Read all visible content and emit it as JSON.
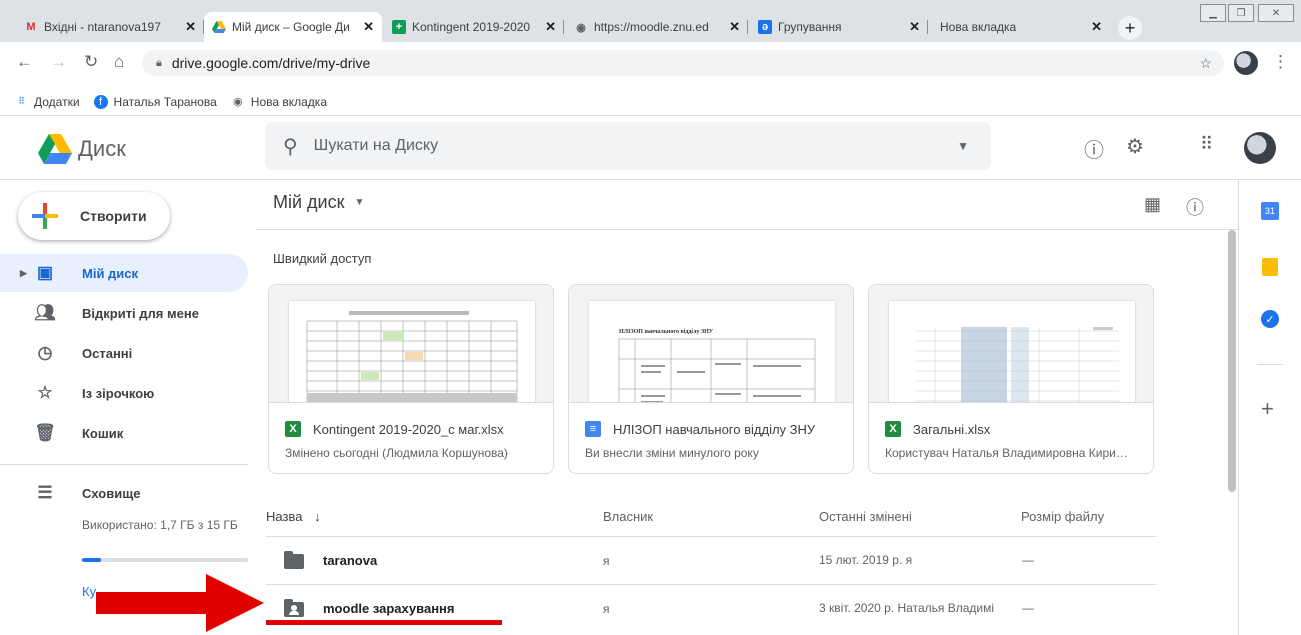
{
  "browser": {
    "tabs": [
      {
        "title": "Вхідні - ntaranova197",
        "icon": "gmail-icon",
        "active": false
      },
      {
        "title": "Мій диск – Google Ди",
        "icon": "google-drive-icon",
        "active": true
      },
      {
        "title": "Kontingent 2019-2020",
        "icon": "google-sheets-icon",
        "active": false
      },
      {
        "title": "https://moodle.znu.ed",
        "icon": "globe-icon",
        "active": false
      },
      {
        "title": "Групування",
        "icon": "moodle-icon",
        "active": false
      },
      {
        "title": "Нова вкладка",
        "icon": "",
        "active": false
      }
    ],
    "url": "drive.google.com/drive/my-drive",
    "bookmarks": [
      {
        "label": "Додатки",
        "icon": "apps-grid-icon"
      },
      {
        "label": "Наталья Таранова",
        "icon": "facebook-icon"
      },
      {
        "label": "Нова вкладка",
        "icon": "globe-icon"
      }
    ]
  },
  "header": {
    "brand": "Диск",
    "search_placeholder": "Шукати на Диску"
  },
  "sidebar": {
    "create_label": "Створити",
    "items": [
      {
        "label": "Мій диск",
        "icon": "my-drive-icon",
        "active": true
      },
      {
        "label": "Відкриті для мене",
        "icon": "shared-icon",
        "active": false
      },
      {
        "label": "Останні",
        "icon": "clock-icon",
        "active": false
      },
      {
        "label": "Із зірочкою",
        "icon": "star-icon",
        "active": false
      },
      {
        "label": "Кошик",
        "icon": "trash-icon",
        "active": false
      }
    ],
    "storage_label": "Сховище",
    "storage_used": "Використано: 1,7 ГБ з 15 ГБ",
    "storage_fraction": 0.113,
    "buy_link": "Ку"
  },
  "main": {
    "title": "Мій диск",
    "quick_access_label": "Швидкий доступ",
    "cards": [
      {
        "name": "Kontingent 2019-2020_c маг.xlsx",
        "subtitle": "Змінено сьогодні (Людмила Коршунова)",
        "type": "X",
        "color": "#1e8e3e"
      },
      {
        "name": "НЛІЗОП навчального відділу ЗНУ",
        "subtitle": "Ви внесли зміни минулого року",
        "type": "≡",
        "color": "#4285f4"
      },
      {
        "name": "Загальні.xlsx",
        "subtitle": "Користувач Наталья Владимировна Кири…",
        "type": "X",
        "color": "#1e8e3e"
      }
    ],
    "columns": {
      "name": "Назва",
      "owner": "Власник",
      "modified": "Останні змінені",
      "size": "Розмір файлу"
    },
    "files": [
      {
        "name": "taranova",
        "owner": "я",
        "modified": "15 лют. 2019 р. я",
        "size": "—",
        "shared": false
      },
      {
        "name": "moodle зарахування",
        "owner": "я",
        "modified": "3 квіт. 2020 р. Наталья Владимі",
        "size": "—",
        "shared": true
      }
    ]
  },
  "doc_thumb": {
    "heading": "НЛІЗОП навчального відділу ЗНУ"
  },
  "colors": {
    "accent": "#1a73e8",
    "active_bg": "#e8f0fe",
    "annotation": "#e00000"
  }
}
